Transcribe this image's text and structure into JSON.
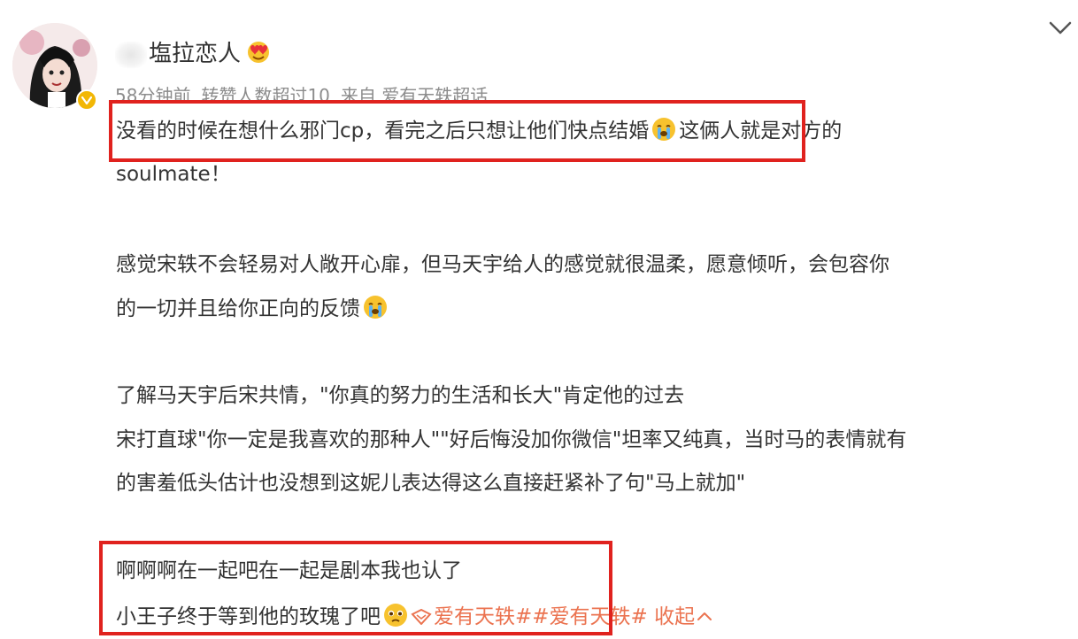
{
  "post": {
    "username": "塩拉恋人",
    "meta": {
      "time": "58分钟前",
      "reposts": "转赞人数超过10",
      "source": "来自 爱有天轶超话"
    },
    "content": {
      "line1_a": "没看的时候在想什么邪门cp，看完之后只想让他们快点结婚",
      "line1_b": "这俩人就是对方的",
      "line2": "soulmate！",
      "line3": "感觉宋轶不会轻易对人敞开心扉，但马天宇给人的感觉就很温柔，愿意倾听，会包容你",
      "line4": "的一切并且给你正向的反馈",
      "line5": "了解马天宇后宋共情，\"你真的努力的生活和长大\"肯定他的过去",
      "line6": "宋打直球\"你一定是我喜欢的那种人\"\"好后悔没加你微信\"坦率又纯真，当时马的表情就有",
      "line7": "的害羞低头估计也没想到这妮儿表达得这么直接赶紧补了句\"马上就加\"",
      "line8": "啊啊啊在一起吧在一起是剧本我也认了",
      "line9": "小王子终于等到他的玫瑰了吧",
      "topic1": "爱有天轶#",
      "topic2": "#爱有天轶#",
      "collapse": "收起"
    }
  },
  "icons": {
    "avatar": "avatar-image",
    "verified": "verified-badge-icon",
    "badge": "heart-eyes-badge-icon",
    "chevron": "chevron-down-icon",
    "crying": "crying-emoji-icon",
    "pleading": "pleading-emoji-icon",
    "link": "topic-link-icon",
    "collapse": "chevron-up-icon"
  },
  "colors": {
    "text": "#333333",
    "meta": "#8c8c8c",
    "topic": "#eb7350",
    "highlight": "#e0221e",
    "verified": "#f2b705"
  }
}
